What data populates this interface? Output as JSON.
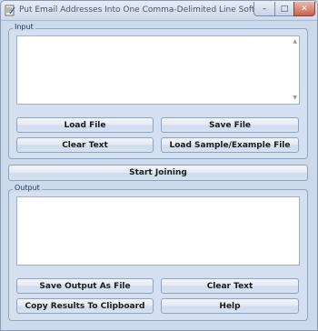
{
  "window": {
    "title": "Put Email Addresses Into One Comma-Delimited Line Software",
    "minimize_glyph": "–",
    "maximize_glyph": "□",
    "close_glyph": "✕"
  },
  "input_group": {
    "label": "Input",
    "text": "",
    "buttons": {
      "load_file": "Load File",
      "save_file": "Save File",
      "clear_text": "Clear Text",
      "load_sample": "Load Sample/Example File"
    }
  },
  "start_button": "Start Joining",
  "output_group": {
    "label": "Output",
    "text": "",
    "buttons": {
      "save_output": "Save Output As File",
      "clear_text": "Clear Text",
      "copy_results": "Copy Results To Clipboard",
      "help": "Help"
    }
  },
  "scroll": {
    "up": "▲",
    "down": "▼"
  },
  "icons": {
    "app": "app-icon",
    "minimize": "minimize-icon",
    "maximize": "maximize-icon",
    "close": "close-icon"
  },
  "colors": {
    "window_bg": "#ccdaec",
    "close_button": "#c9634b"
  }
}
